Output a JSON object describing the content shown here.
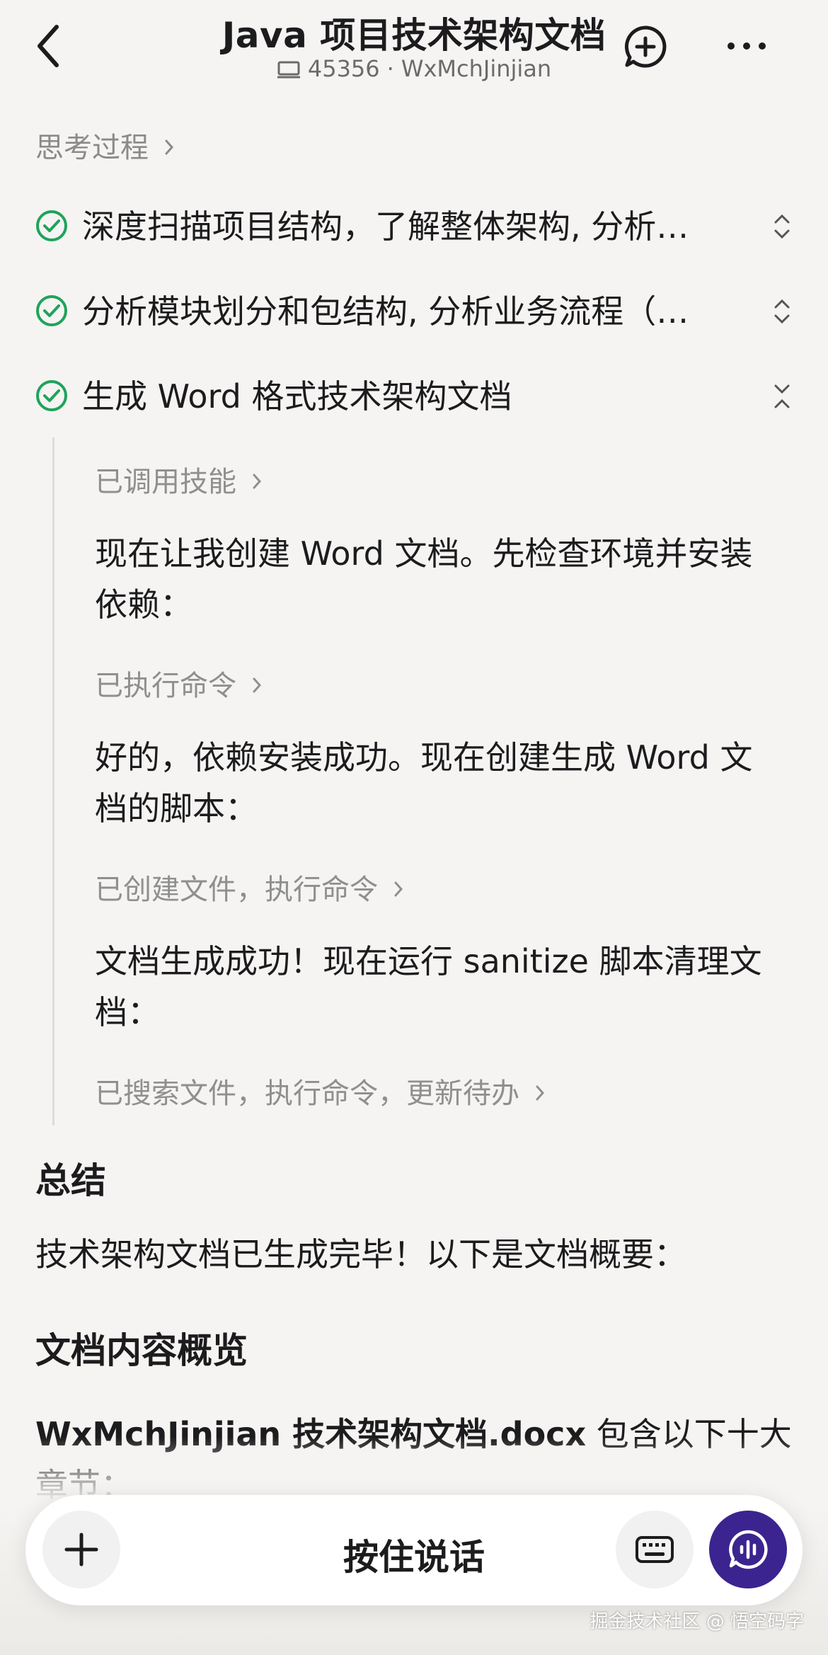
{
  "header": {
    "title": "Java 项目技术架构文档",
    "session_id": "45356",
    "separator": "·",
    "project": "WxMchJinjian"
  },
  "thinking": {
    "label": "思考过程"
  },
  "steps": [
    {
      "text": "深度扫描项目结构，了解整体架构, 分析…",
      "status": "done",
      "expanded": false
    },
    {
      "text": "分析模块划分和包结构, 分析业务流程（…",
      "status": "done",
      "expanded": false
    },
    {
      "text": "生成 Word 格式技术架构文档",
      "status": "done",
      "expanded": true
    }
  ],
  "details": [
    {
      "meta": "已调用技能",
      "text": "现在让我创建 Word 文档。先检查环境并安装依赖："
    },
    {
      "meta": "已执行命令",
      "text": "好的，依赖安装成功。现在创建生成 Word 文档的脚本："
    },
    {
      "meta": "已创建文件，执行命令",
      "text": "文档生成成功！现在运行 sanitize 脚本清理文档："
    },
    {
      "meta": "已搜索文件，执行命令，更新待办",
      "text": ""
    }
  ],
  "summary": {
    "heading": "总结",
    "text": "技术架构文档已生成完毕！以下是文档概要：",
    "overview_heading": "文档内容概览",
    "doc_name": "WxMchJinjian 技术架构文档.docx",
    "doc_desc": " 包含以下十大章节："
  },
  "input_bar": {
    "hold_to_talk": "按住说话"
  },
  "watermark": "掘金技术社区 @ 悟空码字",
  "colors": {
    "accent_green": "#1fa35b",
    "voice_button": "#3b248f"
  }
}
